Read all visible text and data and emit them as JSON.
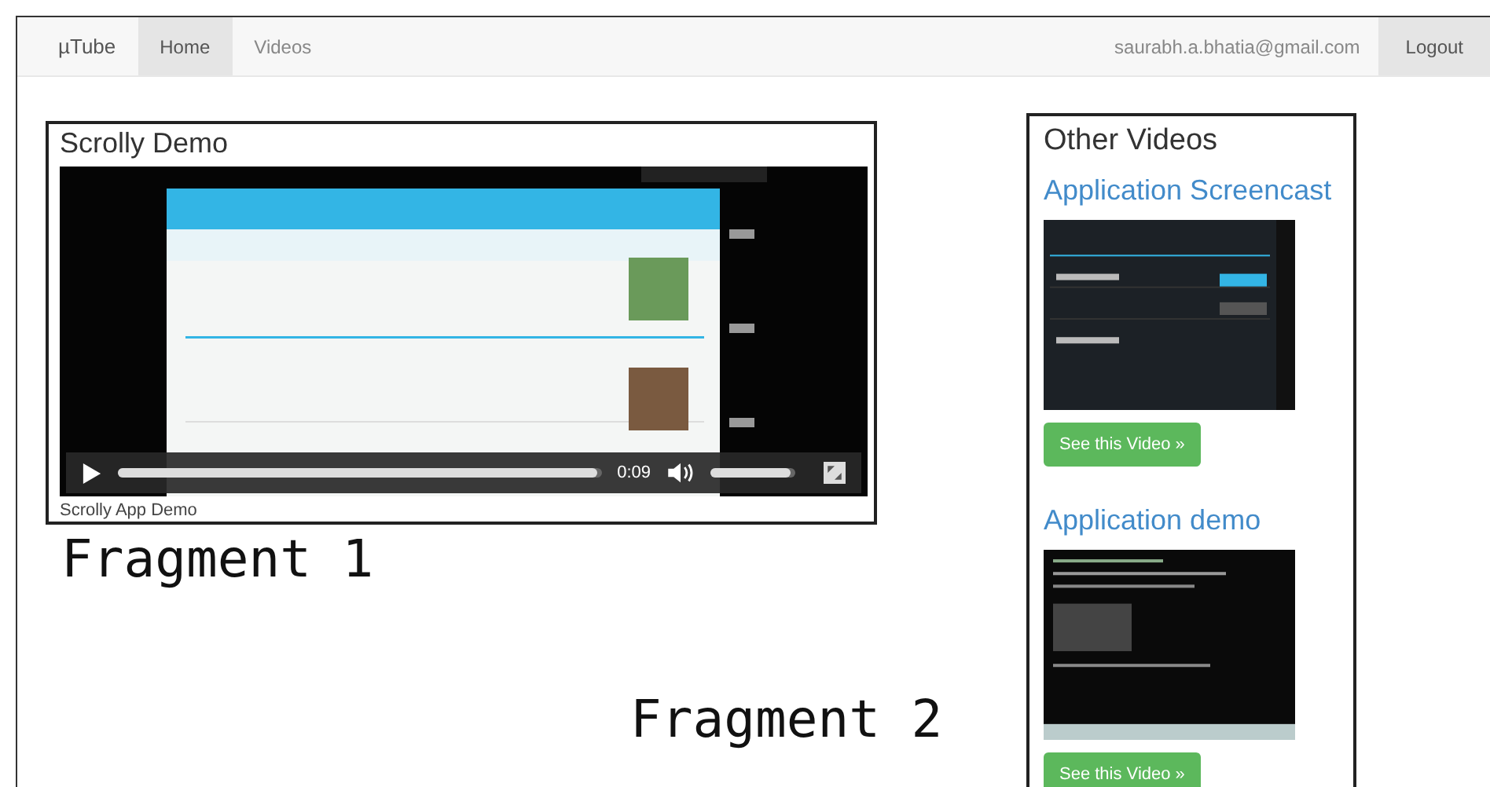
{
  "navbar": {
    "brand": "µTube",
    "tabs": [
      {
        "label": "Home",
        "selected": true
      },
      {
        "label": "Videos",
        "selected": false
      }
    ],
    "user_email": "saurabh.a.bhatia@gmail.com",
    "logout": "Logout"
  },
  "main_video": {
    "title": "Scrolly Demo",
    "player": {
      "kind": "picture",
      "progress": {
        "level": 0.99
      },
      "time": "0:09",
      "volume": {
        "level": 0.95
      }
    },
    "caption": "Scrolly App Demo"
  },
  "annotations": [
    "Fragment 1",
    "Fragment 2"
  ],
  "other_videos": {
    "title": "Other Videos",
    "items": [
      {
        "title": "Application Screencast",
        "button": "See this Video »"
      },
      {
        "title": "Application demo",
        "button": "See this Video »"
      }
    ]
  }
}
